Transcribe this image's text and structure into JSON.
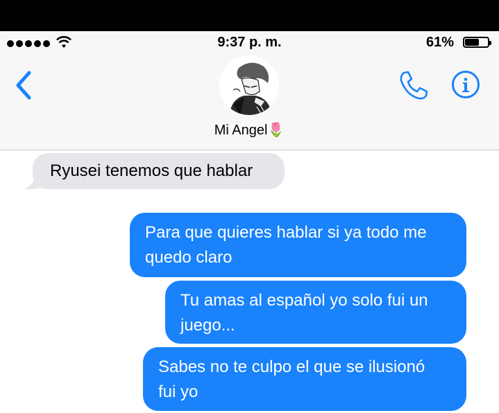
{
  "status_bar": {
    "time": "9:37 p. m.",
    "battery_percent": "61%",
    "battery_level": 0.61
  },
  "header": {
    "contact_name": "Mi Angel",
    "name_emoji": "🌷",
    "back_icon": "chevron-left-icon",
    "call_icon": "phone-icon",
    "info_icon": "info-icon"
  },
  "messages": [
    {
      "direction": "incoming",
      "text": "Ryusei tenemos que hablar"
    },
    {
      "direction": "outgoing",
      "line1": "Para que quieres hablar si ya todo me",
      "line2": "quedo claro"
    },
    {
      "direction": "outgoing",
      "line1": "Tu amas al español yo solo fui un",
      "line2": "juego..."
    },
    {
      "direction": "outgoing",
      "line1": "Sabes no te culpo el que se ilusionó",
      "line2": "fui yo"
    }
  ],
  "colors": {
    "accent": "#1a82fb",
    "incoming_bubble": "#e5e5ea",
    "bar_bg": "#f7f7f7"
  }
}
